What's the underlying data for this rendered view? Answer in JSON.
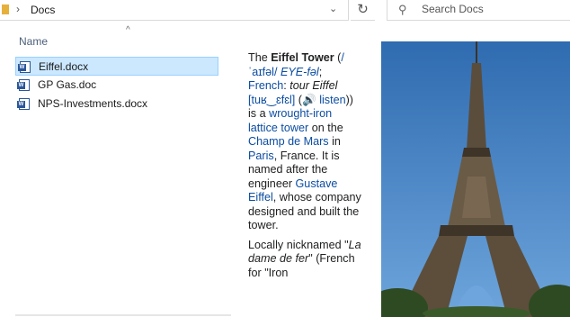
{
  "address_bar": {
    "breadcrumb": "Docs",
    "separator": "›",
    "dropdown_glyph": "⌄",
    "refresh_glyph": "↻"
  },
  "search": {
    "placeholder": "Search Docs",
    "icon": "search-icon"
  },
  "file_list": {
    "sort_indicator": "^",
    "column_name": "Name",
    "files": [
      {
        "name": "Eiffel.docx",
        "selected": true,
        "icon": "word-doc-icon"
      },
      {
        "name": "GP Gas.doc",
        "selected": false,
        "icon": "word-doc-icon"
      },
      {
        "name": "NPS-Investments.docx",
        "selected": false,
        "icon": "word-doc-icon"
      }
    ]
  },
  "preview": {
    "p1": {
      "t1": "The ",
      "t2": "Eiffel Tower",
      "t3": " (",
      "t4": "/ˈaɪfəl/",
      "t5": " ",
      "t6": "EYE-fəl",
      "t7": "; ",
      "t8": "French",
      "t9": ": ",
      "t10": "tour Eiffel",
      "t11": " ",
      "t12": "[tuʁ‿ɛfɛl]",
      "t13": " (",
      "t14": "🔊",
      "t15": " ",
      "t16": "listen",
      "t17": ")) is a ",
      "t18": "wrought-iron lattice tower",
      "t19": " on the ",
      "t20": "Champ de Mars",
      "t21": " in ",
      "t22": "Paris",
      "t23": ", France. It is named after the engineer ",
      "t24": "Gustave Eiffel",
      "t25": ", whose company designed and built the tower."
    },
    "p2": {
      "t1": "Locally nicknamed \"",
      "t2": "La dame de fer",
      "t3": "\" (French for \"Iron"
    }
  },
  "colors": {
    "folder": "#e6b13b",
    "selection": "#cce8ff",
    "link": "#0b4da2",
    "sky": "#3e78b8"
  }
}
